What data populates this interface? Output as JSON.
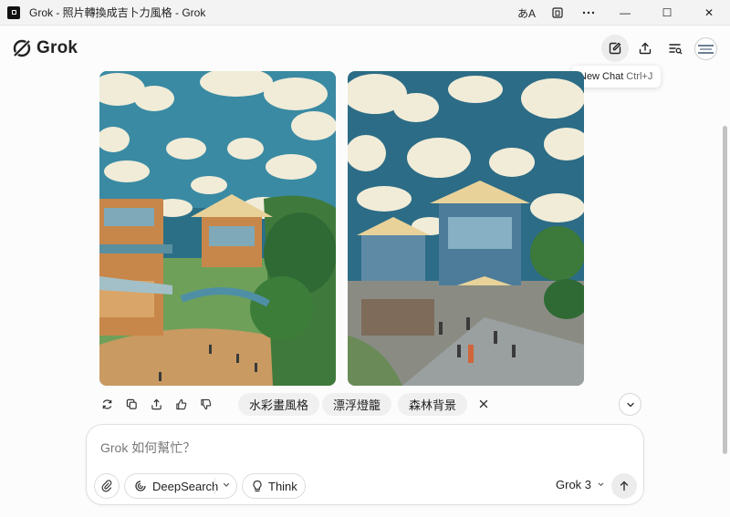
{
  "window": {
    "title": "Grok - 照片轉換成吉卜力風格 - Grok",
    "controls": {
      "translate": "あA",
      "minimize": "—",
      "maximize": "☐",
      "close": "✕"
    }
  },
  "header": {
    "logo_text": "Grok",
    "buttons": [
      "new-chat-icon",
      "share-icon",
      "history-icon"
    ],
    "tooltip": {
      "label": "New Chat",
      "shortcut": "Ctrl+J"
    }
  },
  "images": [
    {
      "description_icon": "ghibli-village-image-1"
    },
    {
      "description_icon": "ghibli-village-image-2"
    }
  ],
  "response_actions": [
    "regenerate-icon",
    "copy-icon",
    "share-icon",
    "thumbs-up-icon",
    "thumbs-down-icon"
  ],
  "suggestions": [
    "水彩畫風格",
    "漂浮燈籠",
    "森林背景"
  ],
  "composer": {
    "placeholder": "Grok 如何幫忙？",
    "deepsearch_label": "DeepSearch",
    "think_label": "Think",
    "model_label": "Grok 3"
  },
  "colors": {
    "accent": "#1a1a1a",
    "background": "#fcfcfc",
    "chip": "#f0f0f0"
  }
}
